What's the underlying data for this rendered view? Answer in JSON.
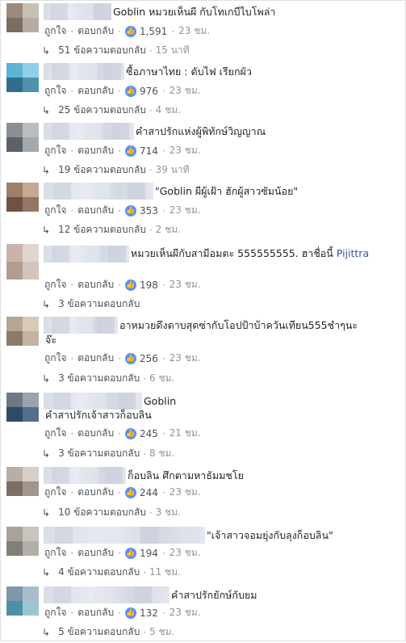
{
  "ui": {
    "like_label": "ถูกใจ",
    "reply_label": "ตอบกลับ",
    "dot": "·",
    "like_glyph": "👍",
    "reply_arrow": "↳"
  },
  "comments": [
    {
      "text": "Goblin หมวยเห็นผี กับโทเกบีไบโพล่า",
      "likes": "1,591",
      "time": "23 ชม.",
      "replies_label": "51 ข้อความตอบกลับ",
      "replies_time": "15 นาที"
    },
    {
      "text": "ซื้อภาษาไทย : ดับไฟ เรียกผัว",
      "likes": "976",
      "time": "23 ชม.",
      "replies_label": "25 ข้อความตอบกลับ",
      "replies_time": "4 ชม."
    },
    {
      "text": "คำสาปรักแห่งผู้พิทักษ์วิญญาณ",
      "likes": "714",
      "time": "23 ชม.",
      "replies_label": "19 ข้อความตอบกลับ",
      "replies_time": "39 นาที"
    },
    {
      "text": "\"Goblin ผีผู้เฝ้า ฮักผู้สาวซัมน้อย\"",
      "likes": "353",
      "time": "23 ชม.",
      "replies_label": "12 ข้อความตอบกลับ",
      "replies_time": "2 ชม."
    },
    {
      "text": "หมวยเห็นผีกับสามีอมตะ 555555555. ฮาชื่อนี้ ",
      "tag": "Pijittra",
      "likes": "198",
      "time": "23 ชม.",
      "replies_label": "3 ข้อความตอบกลับ",
      "replies_time": ""
    },
    {
      "text": "อาหมวยดึงดาบสุดซ่ากับโอปป้าบ้าควันเทียน555ชำๆนะ",
      "text2": "จ๊ะ",
      "likes": "256",
      "time": "23 ชม.",
      "replies_label": "3 ข้อความตอบกลับ",
      "replies_time": "6 ชม."
    },
    {
      "text": "Goblin",
      "text2": "คำสาปรักเจ้าสาวก็อบลิน",
      "likes": "245",
      "time": "21 ชม.",
      "replies_label": "3 ข้อความตอบกลับ",
      "replies_time": "8 ชม."
    },
    {
      "text": "ก็อบลิน ศึกตามหาธัมมชโย",
      "likes": "244",
      "time": "23 ชม.",
      "replies_label": "10 ข้อความตอบกลับ",
      "replies_time": "3 ชม."
    },
    {
      "text": "\"เจ้าสาวจอมยุ่งกับลุงก็อบลิน\"",
      "likes": "194",
      "time": "23 ชม.",
      "replies_label": "4 ข้อความตอบกลับ",
      "replies_time": "11 ชม."
    },
    {
      "text": "คำสาปรักยักษ์กับยม",
      "likes": "132",
      "time": "23 ชม.",
      "replies_label": "5 ข้อความตอบกลับ",
      "replies_time": "5 ชม."
    }
  ]
}
